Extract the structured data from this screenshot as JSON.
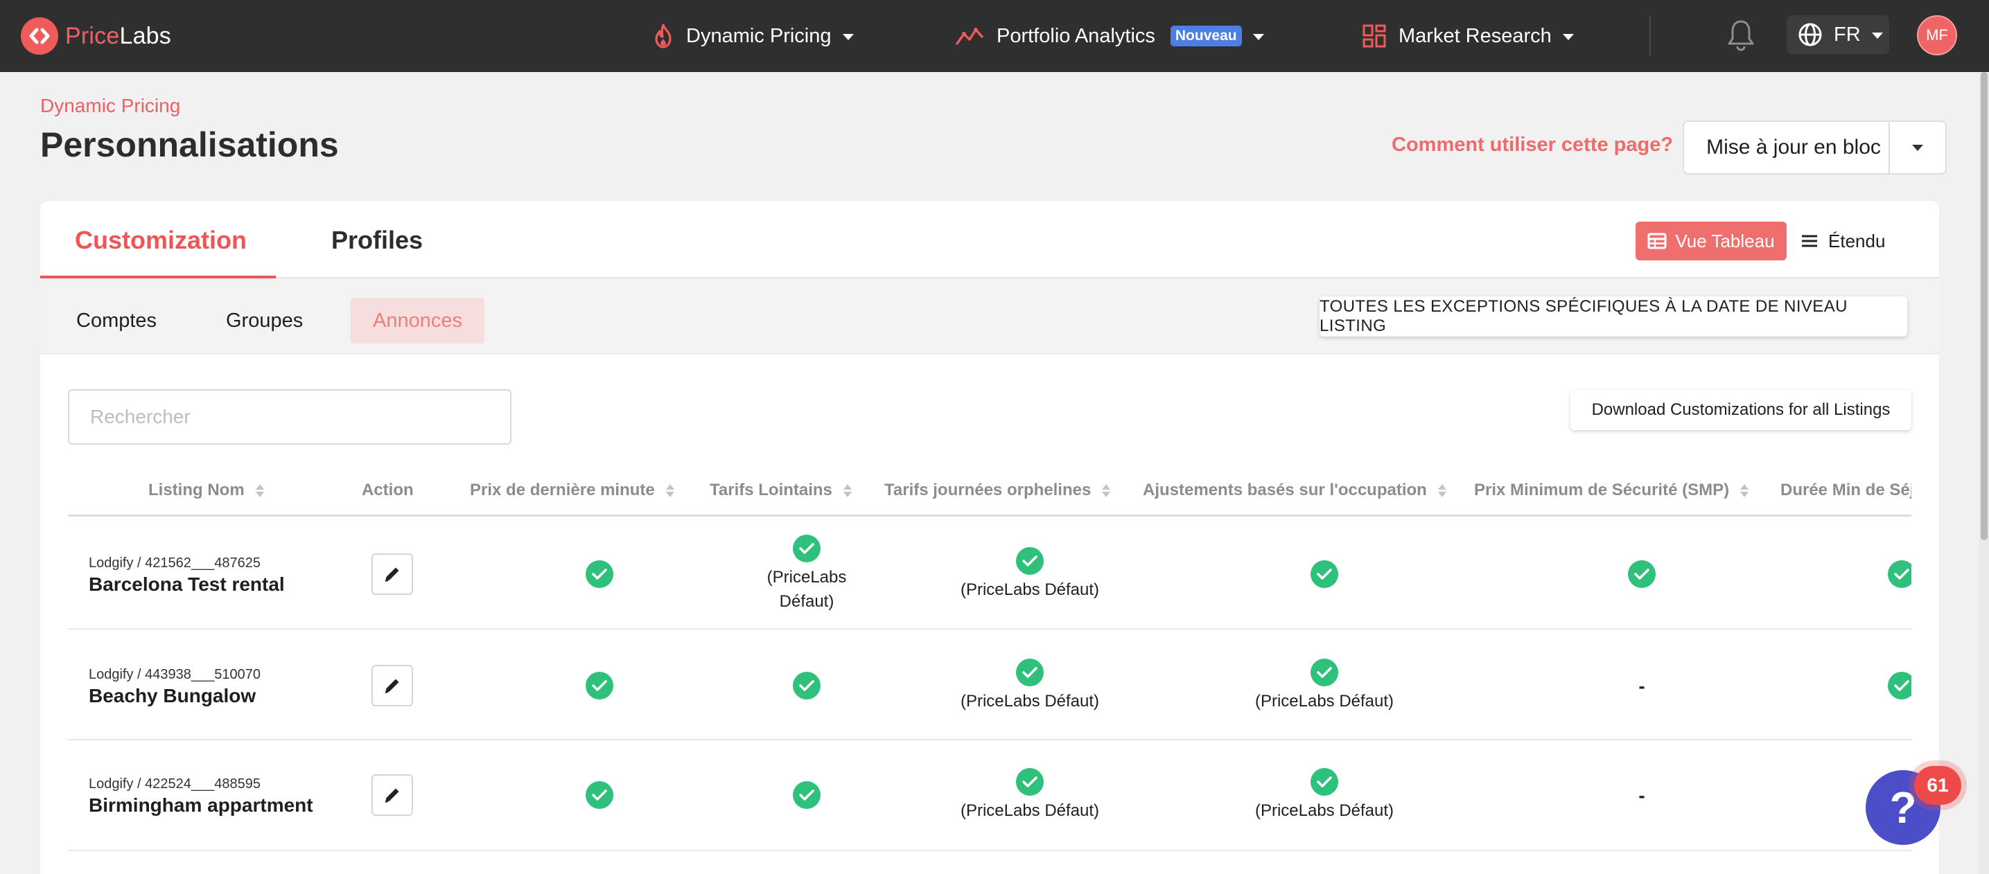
{
  "brand": {
    "name_part1": "Price",
    "name_part2": "Labs",
    "accent": "#ef5a5a"
  },
  "nav": {
    "items": [
      {
        "label": "Dynamic Pricing"
      },
      {
        "label": "Portfolio Analytics",
        "badge": "Nouveau"
      },
      {
        "label": "Market Research"
      }
    ],
    "language": "FR",
    "avatar_initials": "MF"
  },
  "page": {
    "breadcrumb": "Dynamic Pricing",
    "title": "Personnalisations",
    "help_link": "Comment utiliser cette page?",
    "bulk_update_label": "Mise à jour en bloc"
  },
  "card": {
    "tabs": [
      {
        "label": "Customization"
      },
      {
        "label": "Profiles"
      }
    ],
    "view_table_label": "Vue Tableau",
    "extended_label": "Étendu",
    "subtabs": [
      {
        "label": "Comptes"
      },
      {
        "label": "Groupes"
      },
      {
        "label": "Annonces"
      }
    ],
    "exceptions_button": "TOUTES LES EXCEPTIONS SPÉCIFIQUES À LA DATE DE NIVEAU LISTING",
    "search_placeholder": "Rechercher",
    "download_button": "Download Customizations for all Listings"
  },
  "table": {
    "columns": [
      "Listing Nom",
      "Action",
      "Prix de dernière minute",
      "Tarifs Lointains",
      "Tarifs journées orphelines",
      "Ajustements basés sur l'occupation",
      "Prix Minimum de Sécurité (SMP)",
      "Durée Min de Séjour"
    ],
    "rows": [
      {
        "source": "Lodgify / 421562___487625",
        "name": "Barcelona Test rental",
        "cells": [
          {
            "check": true,
            "note": ""
          },
          {
            "check": true,
            "note_line1": "(PriceLabs",
            "note_line2": "Défaut)"
          },
          {
            "check": true,
            "note": "(PriceLabs Défaut)"
          },
          {
            "check": true,
            "note": ""
          },
          {
            "check": true,
            "note": ""
          },
          {
            "check": true,
            "note": ""
          }
        ]
      },
      {
        "source": "Lodgify / 443938___510070",
        "name": "Beachy Bungalow",
        "cells": [
          {
            "check": true,
            "note": ""
          },
          {
            "check": true,
            "note": ""
          },
          {
            "check": true,
            "note": "(PriceLabs Défaut)"
          },
          {
            "check": true,
            "note": "(PriceLabs Défaut)"
          },
          {
            "check": false,
            "text": "-"
          },
          {
            "check": true,
            "note": ""
          }
        ]
      },
      {
        "source": "Lodgify / 422524___488595",
        "name": "Birmingham appartment",
        "cells": [
          {
            "check": true,
            "note": ""
          },
          {
            "check": true,
            "note": ""
          },
          {
            "check": true,
            "note": "(PriceLabs Défaut)"
          },
          {
            "check": true,
            "note": "(PriceLabs Défaut)"
          },
          {
            "check": false,
            "text": "-"
          }
        ]
      }
    ]
  },
  "help_widget": {
    "label": "?",
    "count": "61"
  },
  "colors": {
    "success": "#2fc07c",
    "nav_bg": "#2f2f2f",
    "badge": "#4d7ee6",
    "help_fab": "#4b4ec8"
  }
}
